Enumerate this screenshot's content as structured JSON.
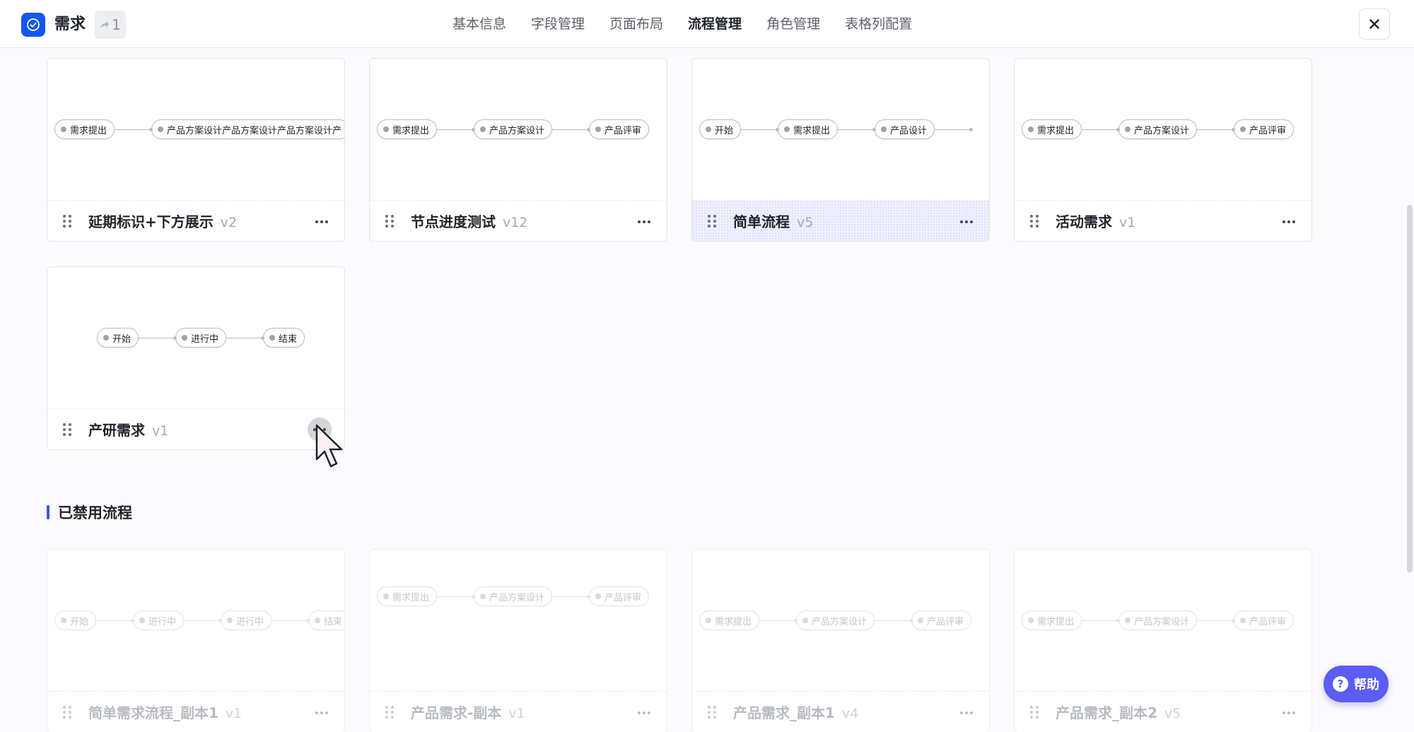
{
  "header": {
    "app_title": "需求",
    "share_count": "1",
    "tabs": [
      "基本信息",
      "字段管理",
      "页面布局",
      "流程管理",
      "角色管理",
      "表格列配置"
    ],
    "active_tab": "流程管理"
  },
  "enabled_flows": [
    {
      "name": "延期标识+下方展示",
      "version": "v2",
      "nodes": [
        "需求提出",
        "产品方案设计产品方案设计产品方案设计产"
      ]
    },
    {
      "name": "节点进度测试",
      "version": "v12",
      "nodes": [
        "需求提出",
        "产品方案设计",
        "产品评审"
      ]
    },
    {
      "name": "简单流程",
      "version": "v5",
      "nodes": [
        "开始",
        "需求提出",
        "产品设计"
      ]
    },
    {
      "name": "活动需求",
      "version": "v1",
      "nodes": [
        "需求提出",
        "产品方案设计",
        "产品评审"
      ]
    },
    {
      "name": "产研需求",
      "version": "v1",
      "nodes": [
        "开始",
        "进行中",
        "结束"
      ]
    }
  ],
  "disabled_section": {
    "title": "已禁用流程"
  },
  "disabled_flows": [
    {
      "name": "简单需求流程_副本1",
      "version": "v1",
      "nodes": [
        "开始",
        "进行中",
        "进行中",
        "结束"
      ]
    },
    {
      "name": "产品需求-副本",
      "version": "v1",
      "nodes": [
        "需求提出",
        "产品方案设计",
        "产品评审"
      ]
    },
    {
      "name": "产品需求_副本1",
      "version": "v4",
      "nodes": [
        "需求提出",
        "产品方案设计",
        "产品评审"
      ]
    },
    {
      "name": "产品需求_副本2",
      "version": "v5",
      "nodes": [
        "需求提出",
        "产品方案设计",
        "产品评审"
      ]
    }
  ],
  "help_button": {
    "label": "帮助"
  },
  "icons": {
    "app": "check-circle-icon",
    "share": "share-arrow-icon",
    "close": "close-icon",
    "drag": "drag-handle-icon",
    "more": "more-horizontal-icon",
    "help": "question-circle-icon"
  },
  "colors": {
    "brand": "#1456f0",
    "section_accent": "#3d55e0",
    "help": "#5b5df4"
  }
}
